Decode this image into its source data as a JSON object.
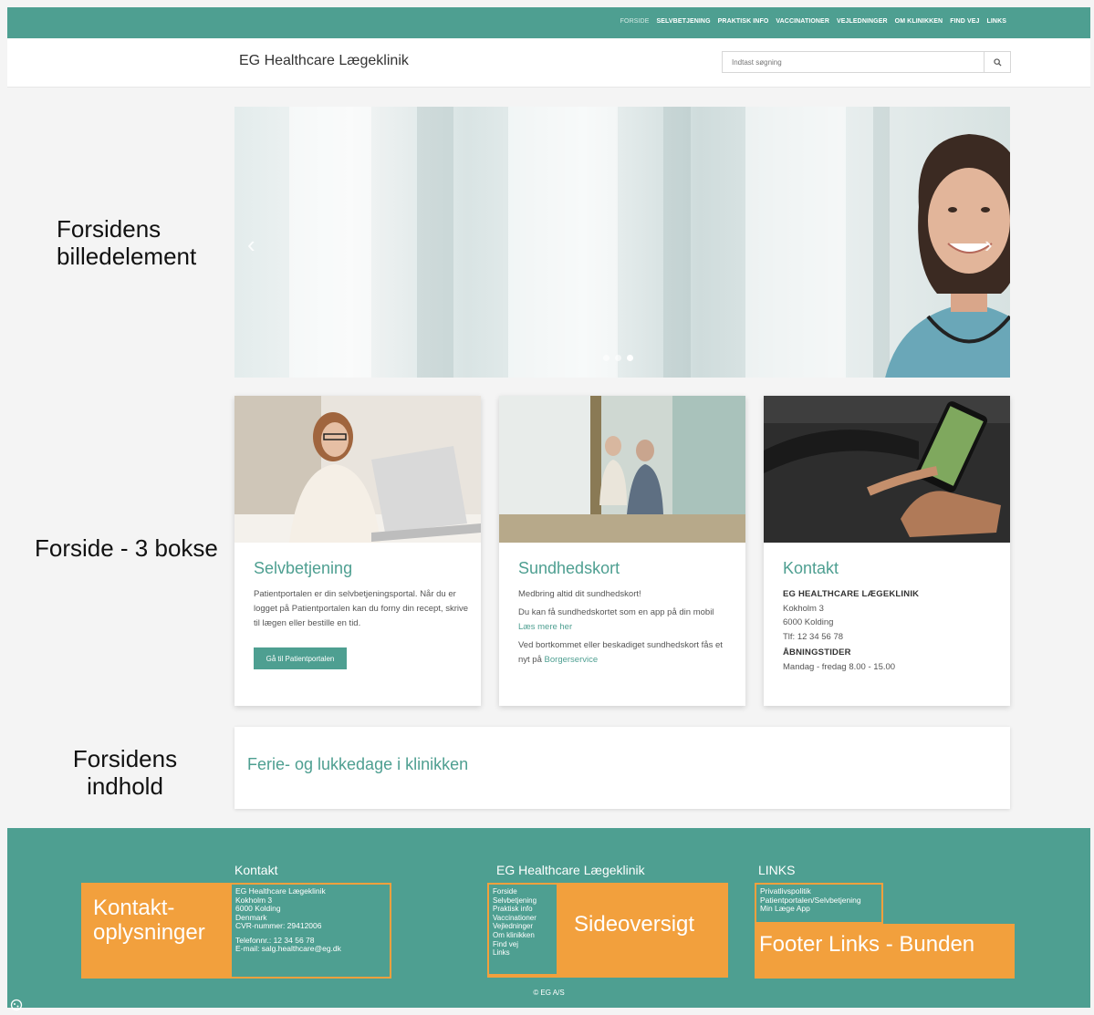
{
  "nav": {
    "items": [
      "FORSIDE",
      "SELVBETJENING",
      "PRAKTISK INFO",
      "VACCINATIONER",
      "VEJLEDNINGER",
      "OM KLINIKKEN",
      "FIND VEJ",
      "LINKS"
    ]
  },
  "header": {
    "title": "EG Healthcare Lægeklinik",
    "search_placeholder": "Indtast søgning"
  },
  "annotations": {
    "hero_line1": "Forsidens",
    "hero_line2": "billedelement",
    "boxes": "Forside - 3 bokse",
    "content_line1": "Forsidens",
    "content_line2": "indhold"
  },
  "cards": {
    "selfservice": {
      "title": "Selvbetjening",
      "text": "Patientportalen er din selvbetjeningsportal. Når du er logget på Patientportalen kan du forny din recept, skrive til lægen eller bestille en tid.",
      "button": "Gå til Patientportalen"
    },
    "healthcard": {
      "title": "Sundhedskort",
      "p1": "Medbring altid dit sundhedskort!",
      "p2": "Du kan få sundhedskortet som en app på din mobil",
      "p2_link": "Læs mere her",
      "p3": "Ved bortkommet eller beskadiget sundhedskort fås et nyt på",
      "p3_link": "Borgerservice"
    },
    "contact": {
      "title": "Kontakt",
      "name": "EG HEALTHCARE LÆGEKLINIK",
      "street": "Kokholm 3",
      "city": "6000 Kolding",
      "phone": "Tlf: 12 34 56 78",
      "hours_title": "ÅBNINGSTIDER",
      "hours": "Mandag - fredag 8.00 - 15.00"
    }
  },
  "content": {
    "heading": "Ferie- og lukkedage i klinikken"
  },
  "footer": {
    "contact": {
      "title": "Kontakt",
      "label_line1": "Kontakt-",
      "label_line2": "oplysninger",
      "lines": [
        "EG Healthcare Lægeklinik",
        "Kokholm 3",
        "6000 Kolding",
        "Denmark",
        "CVR-nummer: 29412006"
      ],
      "phone": "Telefonnr.: 12 34 56 78",
      "email": "E-mail: salg.healthcare@eg.dk"
    },
    "sitemap": {
      "title": "EG Healthcare Lægeklinik",
      "label": "Sideoversigt",
      "links": [
        "Forside",
        "Selvbetjening",
        "Praktisk info",
        "Vaccinationer",
        "Vejledninger",
        "Om klinikken",
        "Find vej",
        "Links"
      ]
    },
    "links": {
      "title": "LINKS",
      "label": "Footer Links - Bunden",
      "items": [
        "Privatlivspolitik",
        "Patientportalen/Selvbetjening",
        "Min Læge App"
      ]
    },
    "copyright": "© EG A/S"
  },
  "colors": {
    "brand": "#4e9f91",
    "annotation": "#f2a03d"
  }
}
